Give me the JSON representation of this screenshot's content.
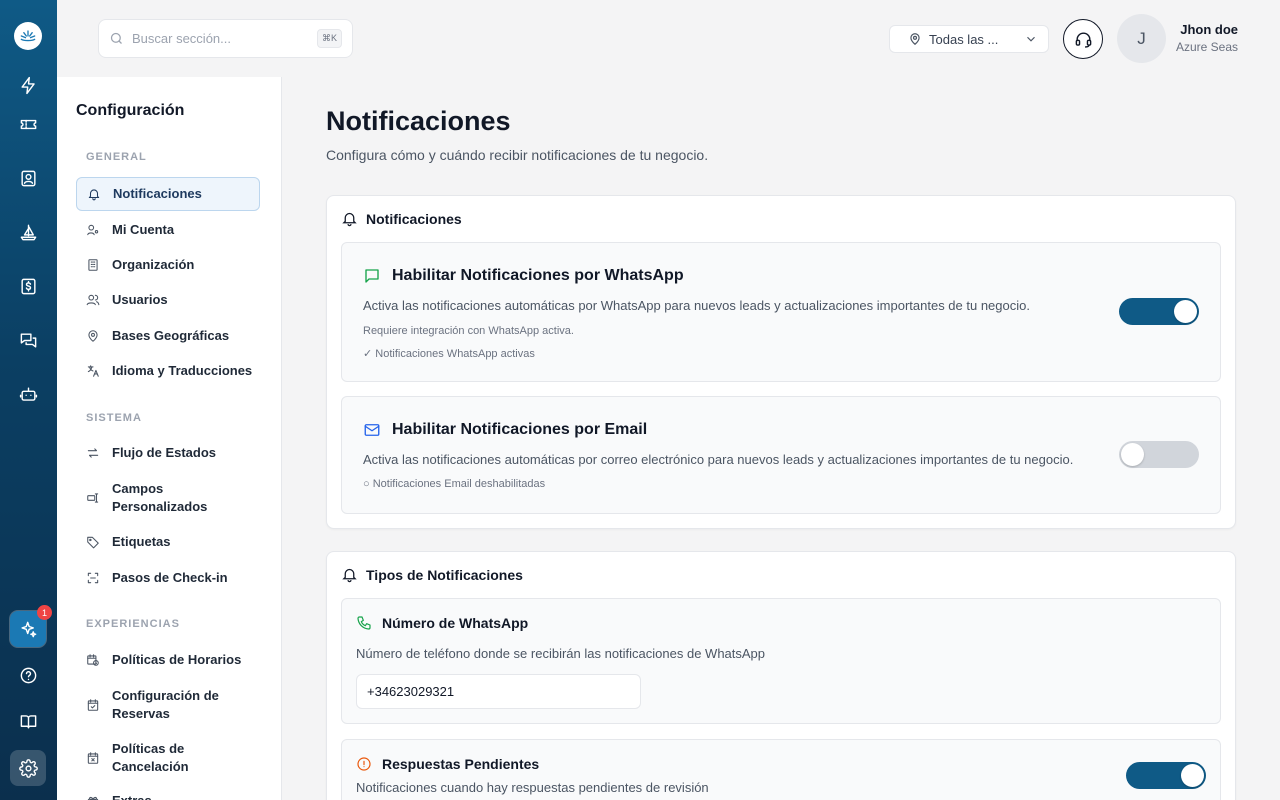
{
  "search": {
    "placeholder": "Buscar sección...",
    "shortcut": "⌘K"
  },
  "location": {
    "label": "Todas las ..."
  },
  "user": {
    "initial": "J",
    "name": "Jhon doe",
    "org": "Azure Seas"
  },
  "rail": {
    "ai_badge": "1"
  },
  "sidebar": {
    "title": "Configuración",
    "sections": [
      {
        "label": "GENERAL",
        "items": [
          "Notificaciones",
          "Mi Cuenta",
          "Organización",
          "Usuarios",
          "Bases Geográficas",
          "Idioma y Traducciones"
        ]
      },
      {
        "label": "SISTEMA",
        "items": [
          "Flujo de Estados",
          "Campos Personalizados",
          "Etiquetas",
          "Pasos de Check-in"
        ]
      },
      {
        "label": "EXPERIENCIAS",
        "items": [
          "Políticas de Horarios",
          "Configuración de Reservas",
          "Políticas de Cancelación",
          "Extras"
        ]
      }
    ]
  },
  "page": {
    "title": "Notificaciones",
    "subtitle": "Configura cómo y cuándo recibir notificaciones de tu negocio."
  },
  "card1": {
    "title": "Notificaciones",
    "whatsapp": {
      "title": "Habilitar Notificaciones por WhatsApp",
      "desc": "Activa las notificaciones automáticas por WhatsApp para nuevos leads y actualizaciones importantes de tu negocio.",
      "note1": "Requiere integración con WhatsApp activa.",
      "note2": "✓ Notificaciones WhatsApp activas",
      "enabled": true
    },
    "email": {
      "title": "Habilitar Notificaciones por Email",
      "desc": "Activa las notificaciones automáticas por correo electrónico para nuevos leads y actualizaciones importantes de tu negocio.",
      "note": "○ Notificaciones Email deshabilitadas",
      "enabled": false
    }
  },
  "card2": {
    "title": "Tipos de Notificaciones",
    "whatsapp_number": {
      "title": "Número de WhatsApp",
      "desc": "Número de teléfono donde se recibirán las notificaciones de WhatsApp",
      "value": "+34623029321"
    },
    "pending": {
      "title": "Respuestas Pendientes",
      "desc": "Notificaciones cuando hay respuestas pendientes de revisión",
      "enabled": true
    }
  },
  "colors": {
    "accent": "#0f5a86",
    "whatsapp_green": "#16a34a",
    "email_blue": "#2563eb",
    "warning_orange": "#ea580c"
  }
}
